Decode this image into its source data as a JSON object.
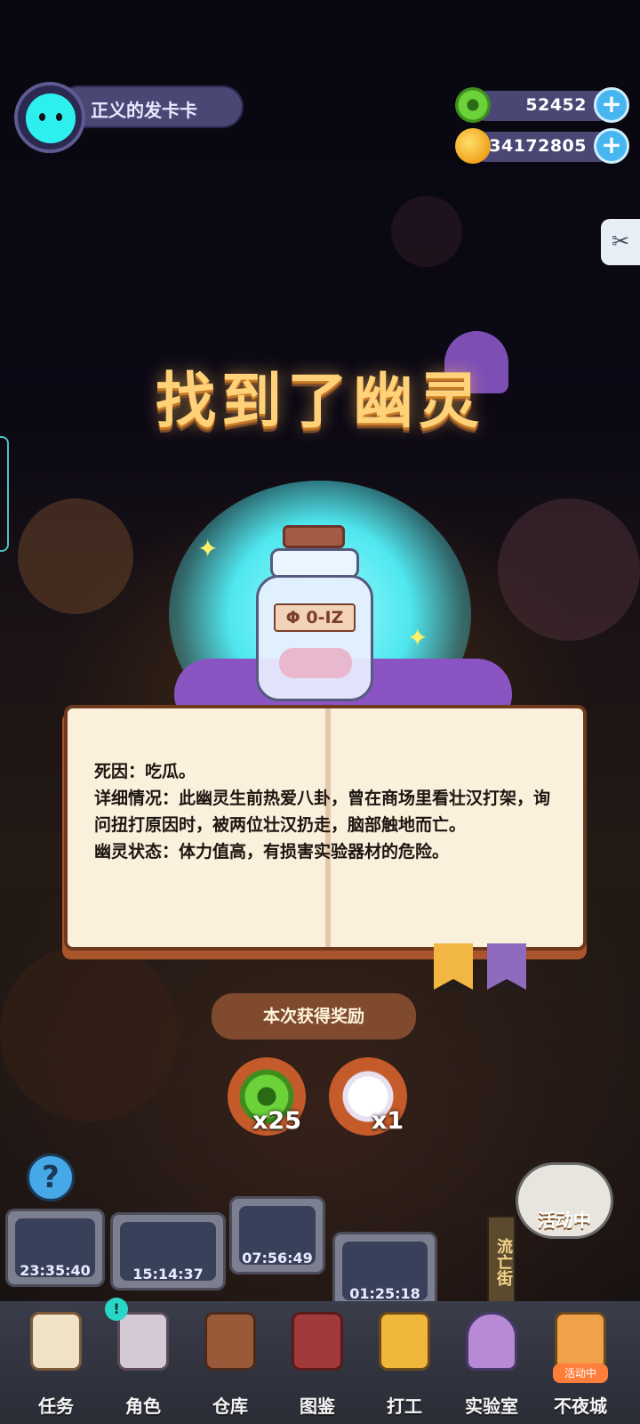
{
  "player": {
    "name": "正义的发卡卡"
  },
  "currency": {
    "donut": {
      "value": "52452",
      "icon": "green-donut-icon"
    },
    "planet": {
      "value": "34172805",
      "icon": "planet-coin-icon"
    }
  },
  "popup": {
    "title": "找到了幽灵",
    "bottle_label": "Φ 0-IZ",
    "cause_line": "死因：吃瓜。",
    "details_line": "详细情况：此幽灵生前热爱八卦，曾在商场里看壮汉打架，询问扭打原因时，被两位壮汉扔走，脑部触地而亡。",
    "status_line": "幽灵状态：体力值高，有损害实验器材的危险。",
    "reward_title": "本次获得奖励",
    "rewards": [
      {
        "icon": "green-donut-icon",
        "qty": "x25"
      },
      {
        "icon": "ghost-icon",
        "qty": "x1"
      }
    ]
  },
  "timers": [
    "23:35:40",
    "15:14:37",
    "07:56:49",
    "01:25:18"
  ],
  "street_label": "流亡街",
  "activity_label": "活动中",
  "nav": {
    "items": [
      {
        "label": "任务",
        "icon": "scroll-icon"
      },
      {
        "label": "角色",
        "icon": "cat-character-icon"
      },
      {
        "label": "仓库",
        "icon": "chest-icon"
      },
      {
        "label": "图鉴",
        "icon": "book-icon"
      },
      {
        "label": "打工",
        "icon": "job-board-icon"
      },
      {
        "label": "实验室",
        "icon": "lab-capsule-icon"
      },
      {
        "label": "不夜城",
        "icon": "night-city-icon"
      }
    ],
    "activity_tag": "活动中"
  },
  "colors": {
    "accent_cyan": "#2df0ee",
    "title_gold": "#ffd27a",
    "book_paper": "#fbf0db"
  }
}
